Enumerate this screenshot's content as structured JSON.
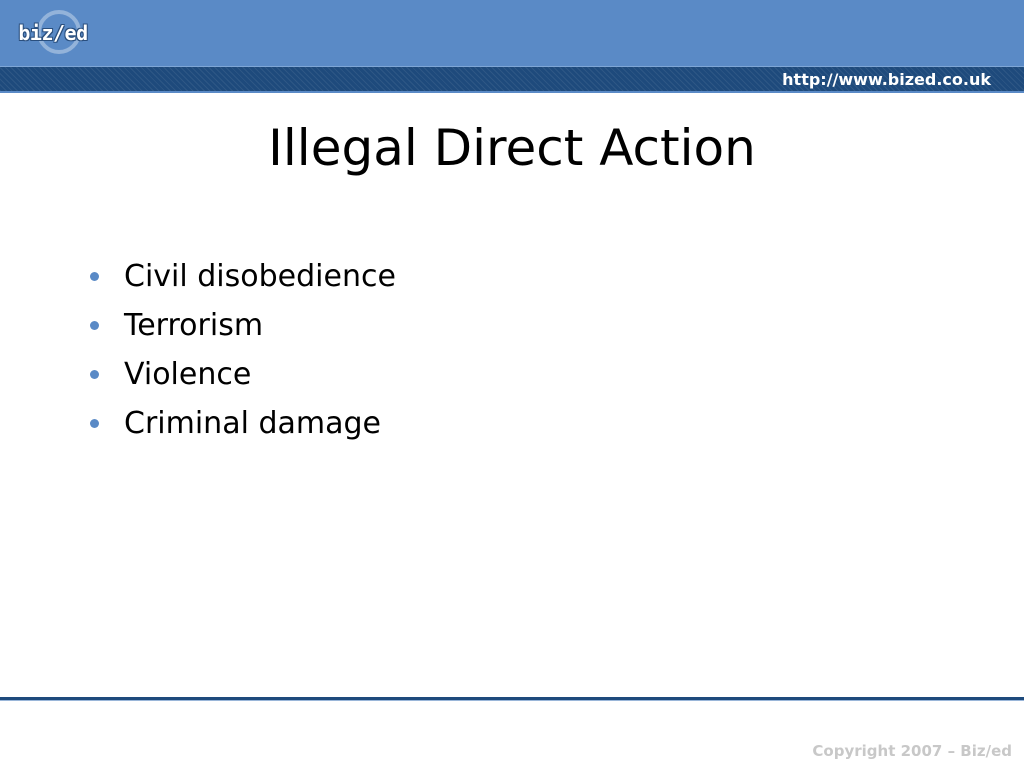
{
  "header": {
    "logo_text": "biz/ed",
    "url": "http://www.bized.co.uk"
  },
  "slide": {
    "title": "Illegal Direct Action",
    "bullets": [
      "Civil disobedience",
      "Terrorism",
      "Violence",
      "Criminal damage"
    ]
  },
  "footer": {
    "copyright": "Copyright 2007 – Biz/ed"
  },
  "colors": {
    "header_blue": "#5a8ac6",
    "strip_navy": "#1e4a7c",
    "bullet_blue": "#5a8ac6",
    "copyright_gray": "#c8c8c8"
  },
  "icons": {
    "logo": "bized-logo-icon",
    "bullet": "bullet-dot-icon"
  }
}
